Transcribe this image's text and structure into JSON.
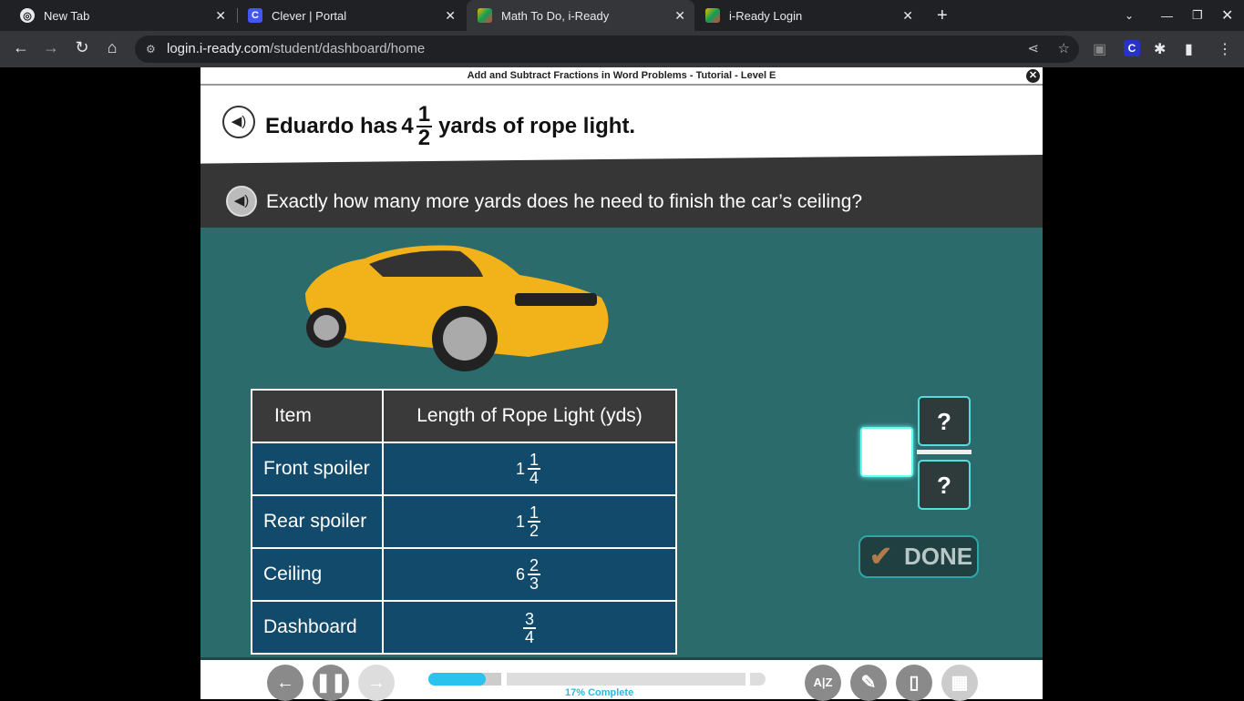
{
  "browser": {
    "tabs": [
      {
        "label": "New Tab",
        "favicon": "chrome-icon",
        "active": false
      },
      {
        "label": "Clever | Portal",
        "favicon": "clever-icon",
        "active": false
      },
      {
        "label": "Math To Do, i-Ready",
        "favicon": "iready-icon",
        "active": true
      },
      {
        "label": "i-Ready Login",
        "favicon": "iready-icon",
        "active": false
      }
    ],
    "url_domain": "login.i-ready.com",
    "url_path": "/student/dashboard/home"
  },
  "lesson": {
    "title": "Add and Subtract Fractions in Word Problems - Tutorial - Level E",
    "q1": {
      "pre": "Eduardo has",
      "whole": "4",
      "num": "1",
      "den": "2",
      "post": "yards of rope light."
    },
    "q2": "Exactly how many more yards does he need to finish the car’s ceiling?",
    "table": {
      "headers": [
        "Item",
        "Length of Rope Light (yds)"
      ],
      "rows": [
        {
          "item": "Front spoiler",
          "whole": "1",
          "num": "1",
          "den": "4"
        },
        {
          "item": "Rear spoiler",
          "whole": "1",
          "num": "1",
          "den": "2"
        },
        {
          "item": "Ceiling",
          "whole": "6",
          "num": "2",
          "den": "3"
        },
        {
          "item": "Dashboard",
          "whole": "",
          "num": "3",
          "den": "4"
        }
      ]
    },
    "answer": {
      "numerator_placeholder": "?",
      "denominator_placeholder": "?",
      "whole": ""
    },
    "done_label": "DONE"
  },
  "progress": {
    "percent": 17,
    "label": "17% Complete"
  },
  "colors": {
    "accent": "#2bb8e0",
    "teal": "#2b6b6b",
    "table_cell": "#114a6b"
  }
}
